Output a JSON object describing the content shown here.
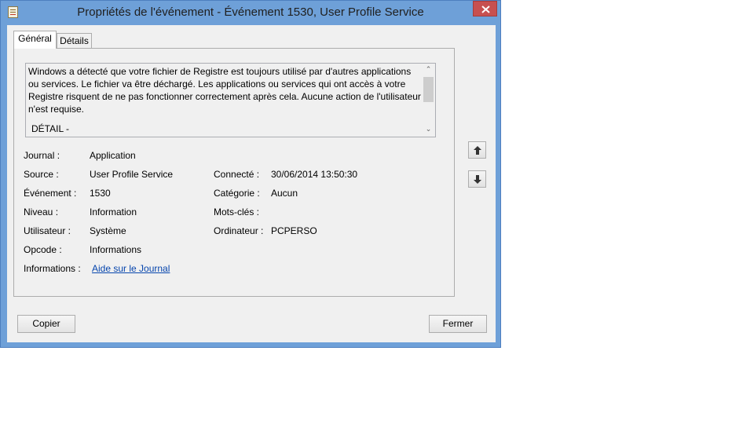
{
  "window": {
    "title": "Propriétés de l'événement - Événement 1530, User Profile Service"
  },
  "tabs": [
    {
      "label": "Général",
      "selected": true
    },
    {
      "label": "Détails",
      "selected": false
    }
  ],
  "description": {
    "text": "Windows a détecté que votre fichier de Registre est toujours utilisé par d'autres applications ou services. Le fichier va être déchargé. Les applications ou services qui ont accès à votre Registre risquent de ne pas fonctionner correctement après cela. Aucune action de l'utilisateur n'est requise.",
    "detail_heading": "DÉTAIL -"
  },
  "fields": {
    "journal": {
      "label": "Journal :",
      "value": "Application"
    },
    "source": {
      "label": "Source :",
      "value": "User Profile Service"
    },
    "evenement": {
      "label": "Événement :",
      "value": "1530"
    },
    "niveau": {
      "label": "Niveau :",
      "value": "Information"
    },
    "utilisateur": {
      "label": "Utilisateur :",
      "value": "Système"
    },
    "opcode": {
      "label": "Opcode :",
      "value": "Informations"
    },
    "informations": {
      "label": "Informations :",
      "value": "Aide sur le Journal"
    },
    "connecte": {
      "label": "Connecté :",
      "value": "30/06/2014 13:50:30"
    },
    "categorie": {
      "label": "Catégorie :",
      "value": "Aucun"
    },
    "motscles": {
      "label": "Mots-clés :",
      "value": ""
    },
    "ordinateur": {
      "label": "Ordinateur :",
      "value": "PCPERSO"
    }
  },
  "buttons": {
    "copy": "Copier",
    "close": "Fermer"
  },
  "icons": {
    "app": "event-properties-icon",
    "close": "close-icon",
    "prev": "arrow-up-icon",
    "next": "arrow-down-icon"
  },
  "colors": {
    "title_bar": "#6ea0d8",
    "close_button": "#c75050",
    "link": "#0645ad"
  }
}
